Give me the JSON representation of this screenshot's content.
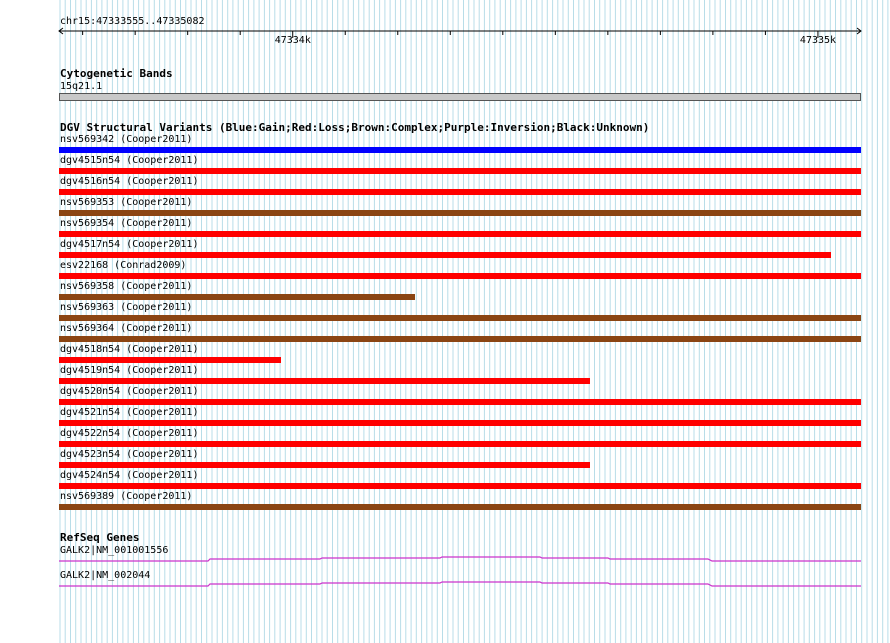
{
  "ruler": {
    "region": "chr15:47333555..47335082",
    "ticks": [
      {
        "label": "47334k",
        "pos": 47334000
      },
      {
        "label": "47335k",
        "pos": 47335000
      }
    ],
    "start": 47333555,
    "end": 47335082
  },
  "colors": {
    "gain": "#0000ff",
    "loss": "#ff0000",
    "complex": "#8b4513",
    "inversion": "#800080",
    "unknown": "#000000",
    "gene": "#cc33cc",
    "grid": "#b8dde8"
  },
  "tracks": {
    "cytoband": {
      "title": "Cytogenetic Bands",
      "band": "15q21.1"
    },
    "dgv": {
      "title": "DGV Structural Variants (Blue:Gain;Red:Loss;Brown:Complex;Purple:Inversion;Black:Unknown)",
      "variants": [
        {
          "label": "nsv569342 (Cooper2011)",
          "type": "gain",
          "fraction": 1.0
        },
        {
          "label": "dgv4515n54 (Cooper2011)",
          "type": "loss",
          "fraction": 1.0
        },
        {
          "label": "dgv4516n54 (Cooper2011)",
          "type": "loss",
          "fraction": 1.0
        },
        {
          "label": "nsv569353 (Cooper2011)",
          "type": "complex",
          "fraction": 1.0
        },
        {
          "label": "nsv569354 (Cooper2011)",
          "type": "loss",
          "fraction": 1.0
        },
        {
          "label": "dgv4517n54 (Cooper2011)",
          "type": "loss",
          "fraction": 0.963
        },
        {
          "label": "esv22168 (Conrad2009)",
          "type": "loss",
          "fraction": 1.0
        },
        {
          "label": "nsv569358 (Cooper2011)",
          "type": "complex",
          "fraction": 0.444
        },
        {
          "label": "nsv569363 (Cooper2011)",
          "type": "complex",
          "fraction": 1.0
        },
        {
          "label": "nsv569364 (Cooper2011)",
          "type": "complex",
          "fraction": 1.0
        },
        {
          "label": "dgv4518n54 (Cooper2011)",
          "type": "loss",
          "fraction": 0.277
        },
        {
          "label": "dgv4519n54 (Cooper2011)",
          "type": "loss",
          "fraction": 0.662
        },
        {
          "label": "dgv4520n54 (Cooper2011)",
          "type": "loss",
          "fraction": 1.0
        },
        {
          "label": "dgv4521n54 (Cooper2011)",
          "type": "loss",
          "fraction": 1.0
        },
        {
          "label": "dgv4522n54 (Cooper2011)",
          "type": "loss",
          "fraction": 1.0
        },
        {
          "label": "dgv4523n54 (Cooper2011)",
          "type": "loss",
          "fraction": 0.662
        },
        {
          "label": "dgv4524n54 (Cooper2011)",
          "type": "loss",
          "fraction": 1.0
        },
        {
          "label": "nsv569389 (Cooper2011)",
          "type": "complex",
          "fraction": 1.0
        }
      ]
    },
    "refseq": {
      "title": "RefSeq Genes",
      "genes": [
        {
          "label": "GALK2|NM_001001556"
        },
        {
          "label": "GALK2|NM_002044"
        }
      ]
    }
  }
}
